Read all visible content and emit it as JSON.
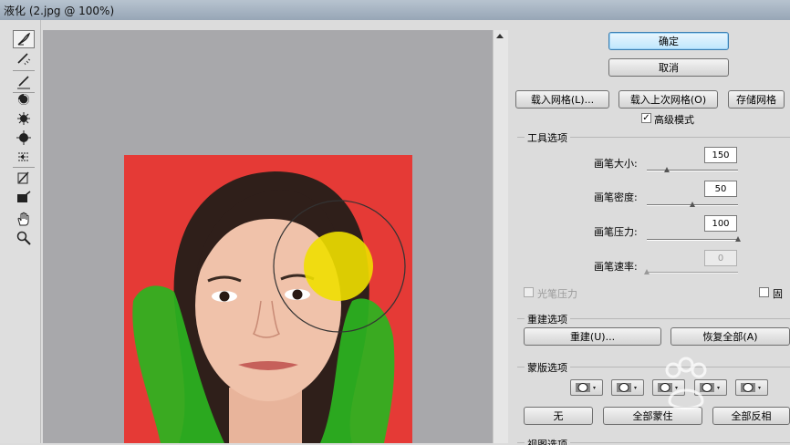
{
  "window": {
    "title": "液化 (2.jpg @ 100%)"
  },
  "tools": [
    {
      "name": "forward-warp-icon"
    },
    {
      "name": "reconstruct-icon"
    },
    {
      "name": "freeze-mask-brush-icon"
    },
    {
      "name": "twirl-icon"
    },
    {
      "name": "pucker-icon"
    },
    {
      "name": "bloat-icon"
    },
    {
      "name": "push-left-icon"
    },
    {
      "name": "mirror-icon"
    },
    {
      "name": "turbulence-icon"
    },
    {
      "name": "hand-icon"
    },
    {
      "name": "zoom-icon"
    }
  ],
  "buttons": {
    "ok": "确定",
    "cancel": "取消",
    "load_mesh": "载入网格(L)...",
    "load_last_mesh": "载入上次网格(O)",
    "save_mesh": "存储网格"
  },
  "advanced_mode": {
    "label": "高级模式",
    "checked": true
  },
  "tool_options": {
    "title": "工具选项",
    "brush_size": {
      "label": "画笔大小:",
      "value": "150",
      "fraction": 0.22
    },
    "brush_density": {
      "label": "画笔密度:",
      "value": "50",
      "fraction": 0.5
    },
    "brush_pressure": {
      "label": "画笔压力:",
      "value": "100",
      "fraction": 1.0
    },
    "brush_rate": {
      "label": "画笔速率:",
      "value": "0",
      "fraction": 0.0
    },
    "stylus_pressure": {
      "label": "光笔压力"
    }
  },
  "reconstruct": {
    "title": "重建选项",
    "rebuild": "重建(U)...",
    "restore_all": "恢复全部(A)"
  },
  "mask": {
    "title": "蒙版选项",
    "none": "无",
    "mask_all": "全部蒙住",
    "invert_all": "全部反相"
  },
  "view_options": {
    "title": "视图选项"
  },
  "colors": {
    "mask_red": "#e53a36",
    "freeze_green": "#2bb41f",
    "brush_yellow": "#f0df00"
  }
}
